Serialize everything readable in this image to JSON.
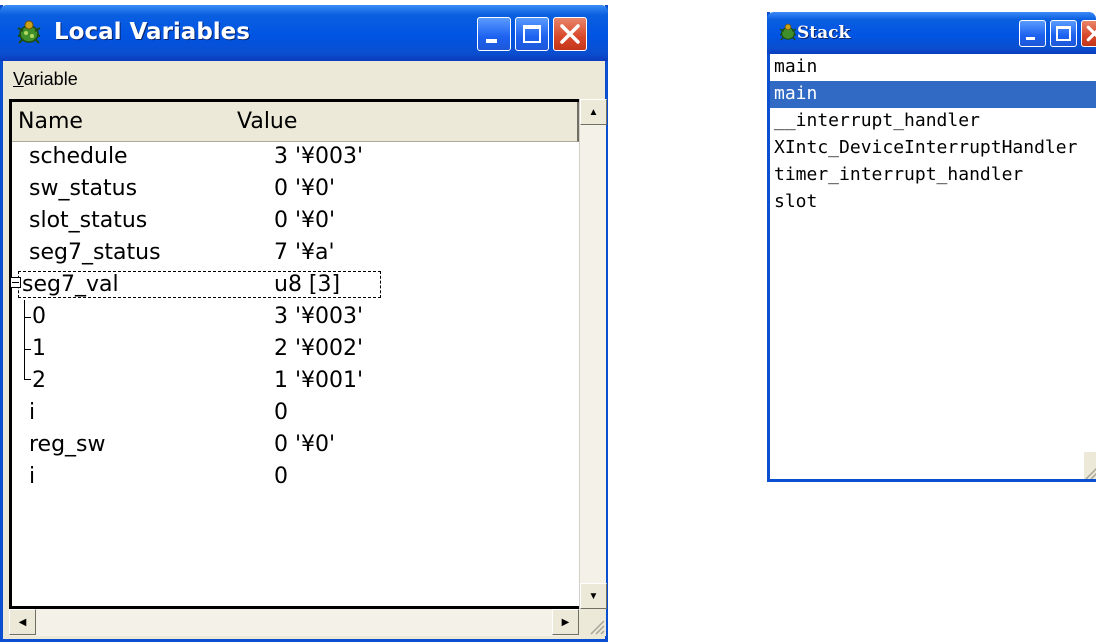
{
  "local_variables_window": {
    "title": "Local Variables",
    "menu": {
      "variable_prefix": "V",
      "variable_rest": "ariable"
    },
    "columns": {
      "name": "Name",
      "value": "Value"
    },
    "rows": [
      {
        "name": "schedule",
        "value": "3 '¥003'"
      },
      {
        "name": "sw_status",
        "value": "0 '¥0'"
      },
      {
        "name": "slot_status",
        "value": "0 '¥0'"
      },
      {
        "name": "seg7_status",
        "value": "7 '¥a'"
      },
      {
        "name": "seg7_val",
        "value": "u8 [3]"
      },
      {
        "name": "0",
        "value": "3 '¥003'"
      },
      {
        "name": "1",
        "value": "2 '¥002'"
      },
      {
        "name": "2",
        "value": "1 '¥001'"
      },
      {
        "name": "i",
        "value": "0"
      },
      {
        "name": "reg_sw",
        "value": "0 '¥0'"
      },
      {
        "name": "i",
        "value": "0"
      }
    ]
  },
  "stack_window": {
    "title": "Stack",
    "frames": [
      "main",
      "main",
      "__interrupt_handler",
      "XIntc_DeviceInterruptHandler",
      "timer_interrupt_handler",
      "slot"
    ],
    "selected_index": 1
  },
  "colors": {
    "title_bar": "#0054e3",
    "selection": "#316ac5",
    "close_button": "#d8472a"
  }
}
